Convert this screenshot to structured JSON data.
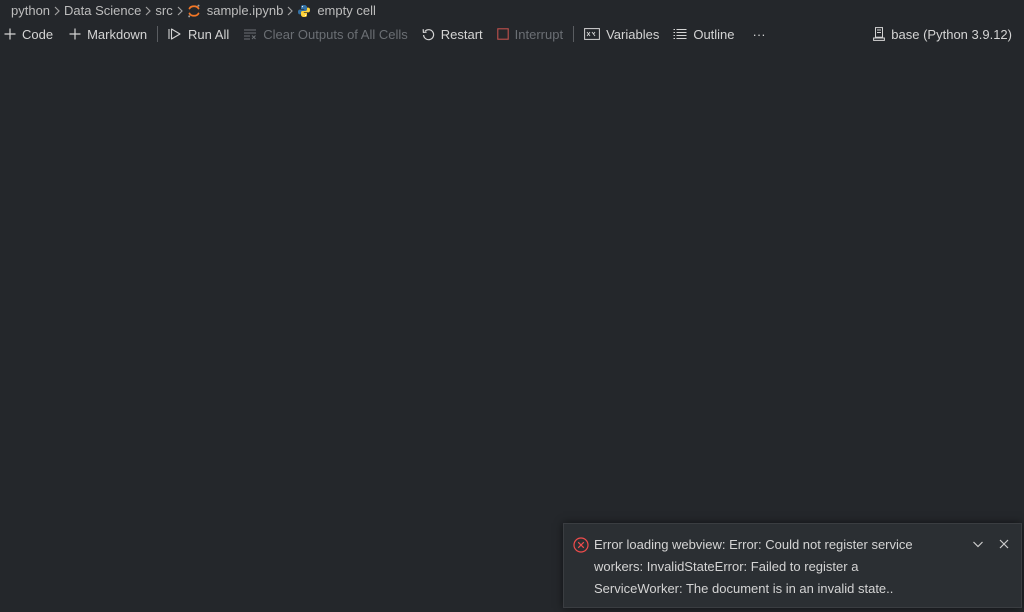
{
  "breadcrumb": {
    "items": [
      "python",
      "Data Science",
      "src",
      "sample.ipynb",
      "empty cell"
    ],
    "separator": ">"
  },
  "toolbar": {
    "code_label": "Code",
    "markdown_label": "Markdown",
    "run_all_label": "Run All",
    "clear_outputs_label": "Clear Outputs of All Cells",
    "restart_label": "Restart",
    "interrupt_label": "Interrupt",
    "variables_label": "Variables",
    "outline_label": "Outline",
    "more_label": "···"
  },
  "kernel": {
    "label": "base (Python 3.9.12)"
  },
  "notification": {
    "severity": "error",
    "message": "Error loading webview: Error: Could not register service workers: InvalidStateError: Failed to register a ServiceWorker: The document is in an invalid state.."
  },
  "colors": {
    "background": "#24272b",
    "error": "#f14c4c",
    "jupyter_orange": "#f37726",
    "python_blue": "#3572A5",
    "python_yellow": "#FFD43B"
  },
  "icons": {
    "notebook": "jupyter-icon",
    "cell": "python-icon",
    "code": "plus-icon",
    "markdown": "plus-icon",
    "run_all": "run-all-icon",
    "clear": "clear-all-icon",
    "restart": "restart-icon",
    "interrupt": "stop-icon",
    "variables": "variables-icon",
    "outline": "list-icon",
    "kernel": "server-environment-icon",
    "error": "error-icon",
    "collapse": "chevron-down-icon",
    "close": "close-icon"
  }
}
